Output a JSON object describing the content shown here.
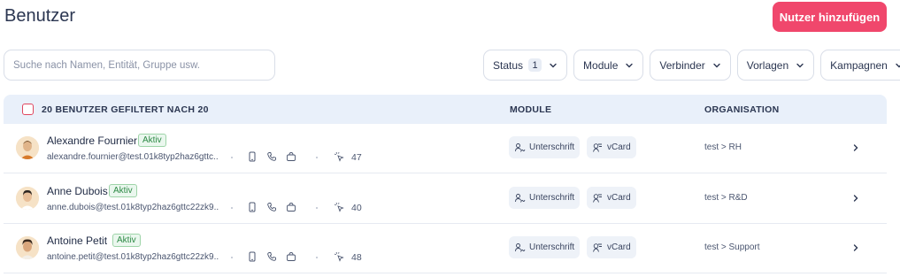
{
  "header": {
    "title": "Benutzer",
    "add_button": "Nutzer hinzufügen"
  },
  "search": {
    "placeholder": "Suche nach Namen, Entität, Gruppe usw.",
    "value": ""
  },
  "filters": [
    {
      "label": "Status",
      "count": "1"
    },
    {
      "label": "Module"
    },
    {
      "label": "Verbinder"
    },
    {
      "label": "Vorlagen"
    },
    {
      "label": "Kampagnen"
    }
  ],
  "table": {
    "headers": {
      "count": "20 BENUTZER GEFILTERT NACH 20",
      "modules": "MODULE",
      "organisation": "ORGANISATION"
    },
    "rows": [
      {
        "name": "Alexandre Fournier",
        "status": "Aktiv",
        "email": "alexandre.fournier@test.01k8typ2haz6gttc...",
        "clicks": "47",
        "module_1": "Unterschrift",
        "module_2": "vCard",
        "org": "test > RH"
      },
      {
        "name": "Anne Dubois",
        "status": "Aktiv",
        "email": "anne.dubois@test.01k8typ2haz6gttc22zk9...",
        "clicks": "40",
        "module_1": "Unterschrift",
        "module_2": "vCard",
        "org": "test > R&D"
      },
      {
        "name": "Antoine Petit",
        "status": "Aktiv",
        "email": "antoine.petit@test.01k8typ2haz6gttc22zk9...",
        "clicks": "48",
        "module_1": "Unterschrift",
        "module_2": "vCard",
        "org": "test > Support"
      }
    ]
  },
  "colors": {
    "accent": "#f0476c",
    "header_bg": "#e9f0fa",
    "badge_green": "#2e8a46"
  },
  "icons": [
    "chevron-down-icon",
    "chevron-right-icon",
    "mobile-icon",
    "phone-icon",
    "bag-icon",
    "cursor-click-icon",
    "signature-icon",
    "vcard-icon"
  ]
}
